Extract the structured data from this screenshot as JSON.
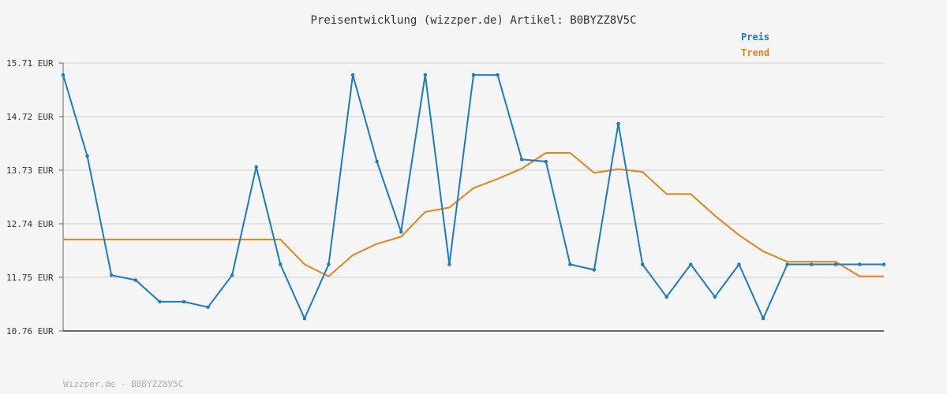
{
  "title": "Preisentwicklung (wizzper.de) Artikel: B0BYZZ8V5C",
  "legend": {
    "preis": "Preis",
    "trend": "Trend",
    "placement": "top-right"
  },
  "footer": "Wizzper.de - B0BYZZ8V5C",
  "colors": {
    "preis": "#1a7cc0",
    "trend": "#e0861a",
    "grid": "#e2e2e2",
    "axis": "#666666",
    "background": "#f5f5f5"
  },
  "chart_data": {
    "type": "line",
    "title": "Preisentwicklung (wizzper.de) Artikel: B0BYZZ8V5C",
    "xlabel": "",
    "ylabel": "",
    "ylim": [
      10.76,
      15.71
    ],
    "y_ticks": [
      "15.71 EUR",
      "14.72 EUR",
      "13.73 EUR",
      "12.74 EUR",
      "11.75 EUR",
      "10.76 EUR"
    ],
    "y_tick_values": [
      15.71,
      14.72,
      13.73,
      12.74,
      11.75,
      10.76
    ],
    "grid": true,
    "x_count": 35,
    "series": [
      {
        "name": "Preis",
        "color": "#1a7cc0",
        "markers": true,
        "values": [
          15.49,
          13.99,
          11.79,
          11.7,
          11.3,
          11.3,
          11.2,
          11.79,
          13.79,
          11.99,
          10.99,
          11.99,
          15.49,
          13.89,
          12.59,
          15.49,
          11.99,
          15.49,
          15.49,
          13.93,
          13.89,
          11.99,
          11.89,
          14.59,
          11.99,
          11.39,
          11.99,
          11.39,
          11.99,
          10.99,
          11.99,
          11.99,
          11.99,
          11.99,
          11.99
        ]
      },
      {
        "name": "Trend",
        "color": "#e0861a",
        "markers": false,
        "values": [
          12.45,
          12.45,
          12.45,
          12.45,
          12.45,
          12.45,
          12.45,
          12.45,
          12.45,
          12.45,
          11.99,
          11.77,
          12.16,
          12.37,
          12.5,
          12.96,
          13.04,
          13.4,
          13.57,
          13.76,
          14.05,
          14.05,
          13.68,
          13.75,
          13.7,
          13.29,
          13.29,
          12.89,
          12.53,
          12.23,
          12.04,
          12.04,
          12.04,
          11.77,
          11.77
        ]
      }
    ]
  }
}
